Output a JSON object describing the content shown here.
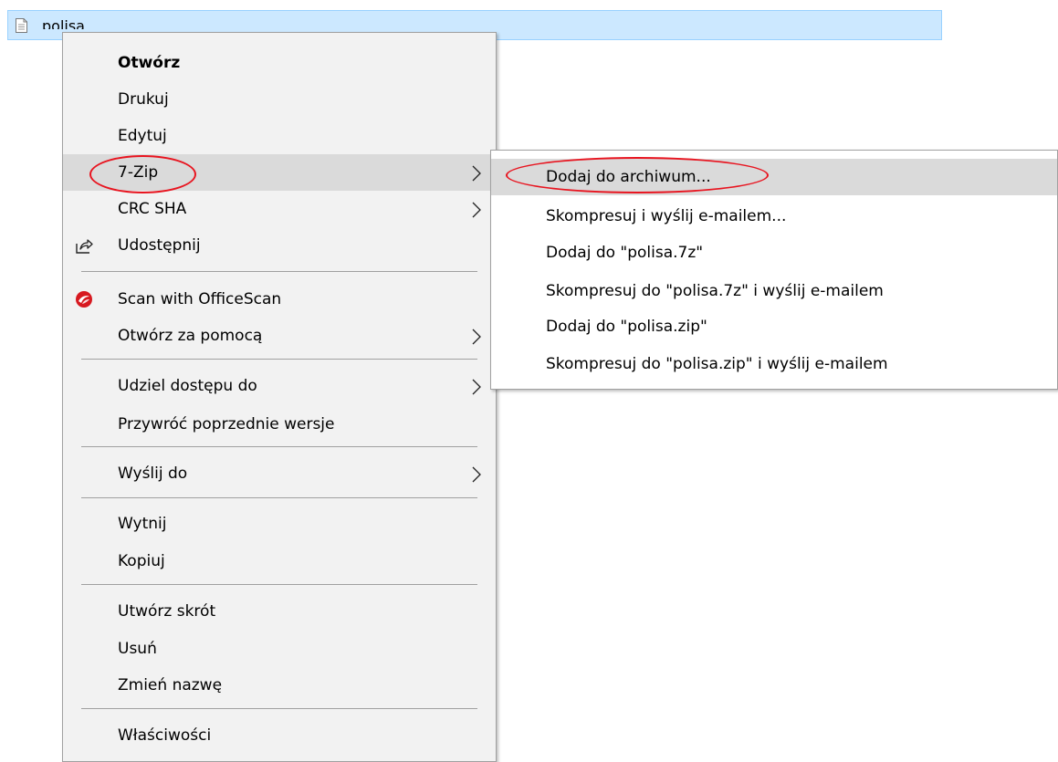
{
  "file": {
    "name": "polisa",
    "icon": "text-file-icon"
  },
  "context_menu": {
    "items": [
      {
        "label": "Otwórz",
        "bold": true
      },
      {
        "label": "Drukuj"
      },
      {
        "label": "Edytuj"
      },
      {
        "label": "7-Zip",
        "submenu": true,
        "highlighted": true
      },
      {
        "label": "CRC SHA",
        "submenu": true
      },
      {
        "label": "Udostępnij",
        "icon": "share-icon"
      },
      {
        "label": "Scan with OfficeScan",
        "icon": "officescan-icon"
      },
      {
        "label": "Otwórz za pomocą",
        "submenu": true
      },
      {
        "label": "Udziel dostępu do",
        "submenu": true
      },
      {
        "label": "Przywróć poprzednie wersje"
      },
      {
        "label": "Wyślij do",
        "submenu": true
      },
      {
        "label": "Wytnij"
      },
      {
        "label": "Kopiuj"
      },
      {
        "label": "Utwórz skrót"
      },
      {
        "label": "Usuń"
      },
      {
        "label": "Zmień nazwę"
      },
      {
        "label": "Właściwości"
      }
    ]
  },
  "submenu_7zip": {
    "items": [
      {
        "label": "Dodaj do archiwum...",
        "highlighted": true
      },
      {
        "label": "Skompresuj i wyślij e-mailem..."
      },
      {
        "label": "Dodaj do \"polisa.7z\""
      },
      {
        "label": "Skompresuj do \"polisa.7z\" i wyślij e-mailem"
      },
      {
        "label": "Dodaj do \"polisa.zip\""
      },
      {
        "label": "Skompresuj do \"polisa.zip\" i wyślij e-mailem"
      }
    ]
  },
  "colors": {
    "selection": "#cce8ff",
    "menu_bg": "#f2f2f2",
    "highlight": "#dadada",
    "annotation": "#e8141f"
  }
}
